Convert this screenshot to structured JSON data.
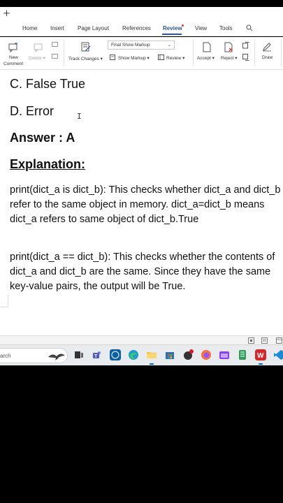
{
  "titlebar": {
    "new_tab": "+"
  },
  "menu": {
    "tabs": [
      {
        "label": "Home"
      },
      {
        "label": "Insert"
      },
      {
        "label": "Page Layout"
      },
      {
        "label": "References"
      },
      {
        "label": "Review"
      },
      {
        "label": "View"
      },
      {
        "label": "Tools"
      }
    ],
    "active_tab": "Review"
  },
  "ribbon": {
    "new_comment": "New\nComment",
    "delete": "Delete",
    "track_changes": "Track Changes",
    "markup_mode": "Final Show Markup",
    "show_markup": "Show Markup",
    "review": "Review",
    "accept": "Accept",
    "reject": "Reject",
    "draw": "Draw"
  },
  "document": {
    "option_c": "C. False True",
    "option_d": "D. Error",
    "answer": "Answer : A",
    "explanation_heading": "Explanation",
    "explanation_colon": ":",
    "para1": "print(dict_a is dict_b): This checks whether dict_a and dict_b refer to the same object in memory. dict_a=dict_b means dict_a refers to same object  of dict_b.True",
    "para2": "print(dict_a == dict_b): This checks whether the contents of dict_a and dict_b are the same. Since they have the same key-value pairs, the output will be True."
  },
  "taskbar": {
    "search_placeholder": "arch"
  },
  "colors": {
    "accent": "#2b579a",
    "taskbar": "#e9ecef"
  }
}
